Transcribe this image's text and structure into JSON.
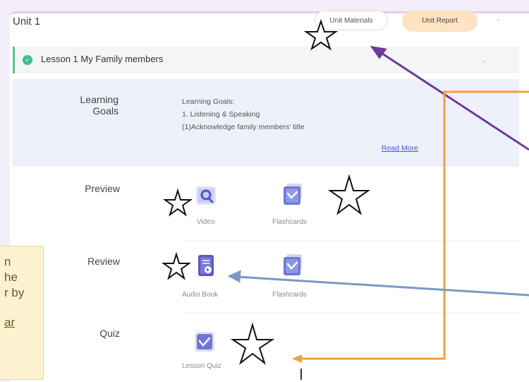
{
  "header": {
    "unit_title": "Unit 1",
    "unit_materials_label": "Unit Materials",
    "unit_report_label": "Unit Report"
  },
  "lesson": {
    "label": "Lesson 1 My Family members"
  },
  "learning_goals": {
    "title_line1": "Learning",
    "title_line2": "Goals",
    "lines": [
      "Learning Goals:",
      "1. Listening & Speaking",
      "(1)Acknowledge family members' title"
    ],
    "read_more": "Read More"
  },
  "sections": {
    "preview": {
      "label": "Preview",
      "items": [
        "Video",
        "Flashcards"
      ]
    },
    "review": {
      "label": "Review",
      "items": [
        "Audio Book",
        "Flashcards"
      ]
    },
    "quiz": {
      "label": "Quiz",
      "items": [
        "Lesson Quiz"
      ]
    }
  },
  "callout": {
    "lines": [
      "n",
      "he",
      "r by",
      "ar"
    ]
  },
  "colors": {
    "accent_green": "#3fbf8a",
    "report_button": "#fde3c1",
    "goals_panel": "#eef0fa",
    "annotation_purple": "#6b3a9a",
    "annotation_orange": "#f0a040",
    "annotation_blue": "#7a99c4"
  }
}
